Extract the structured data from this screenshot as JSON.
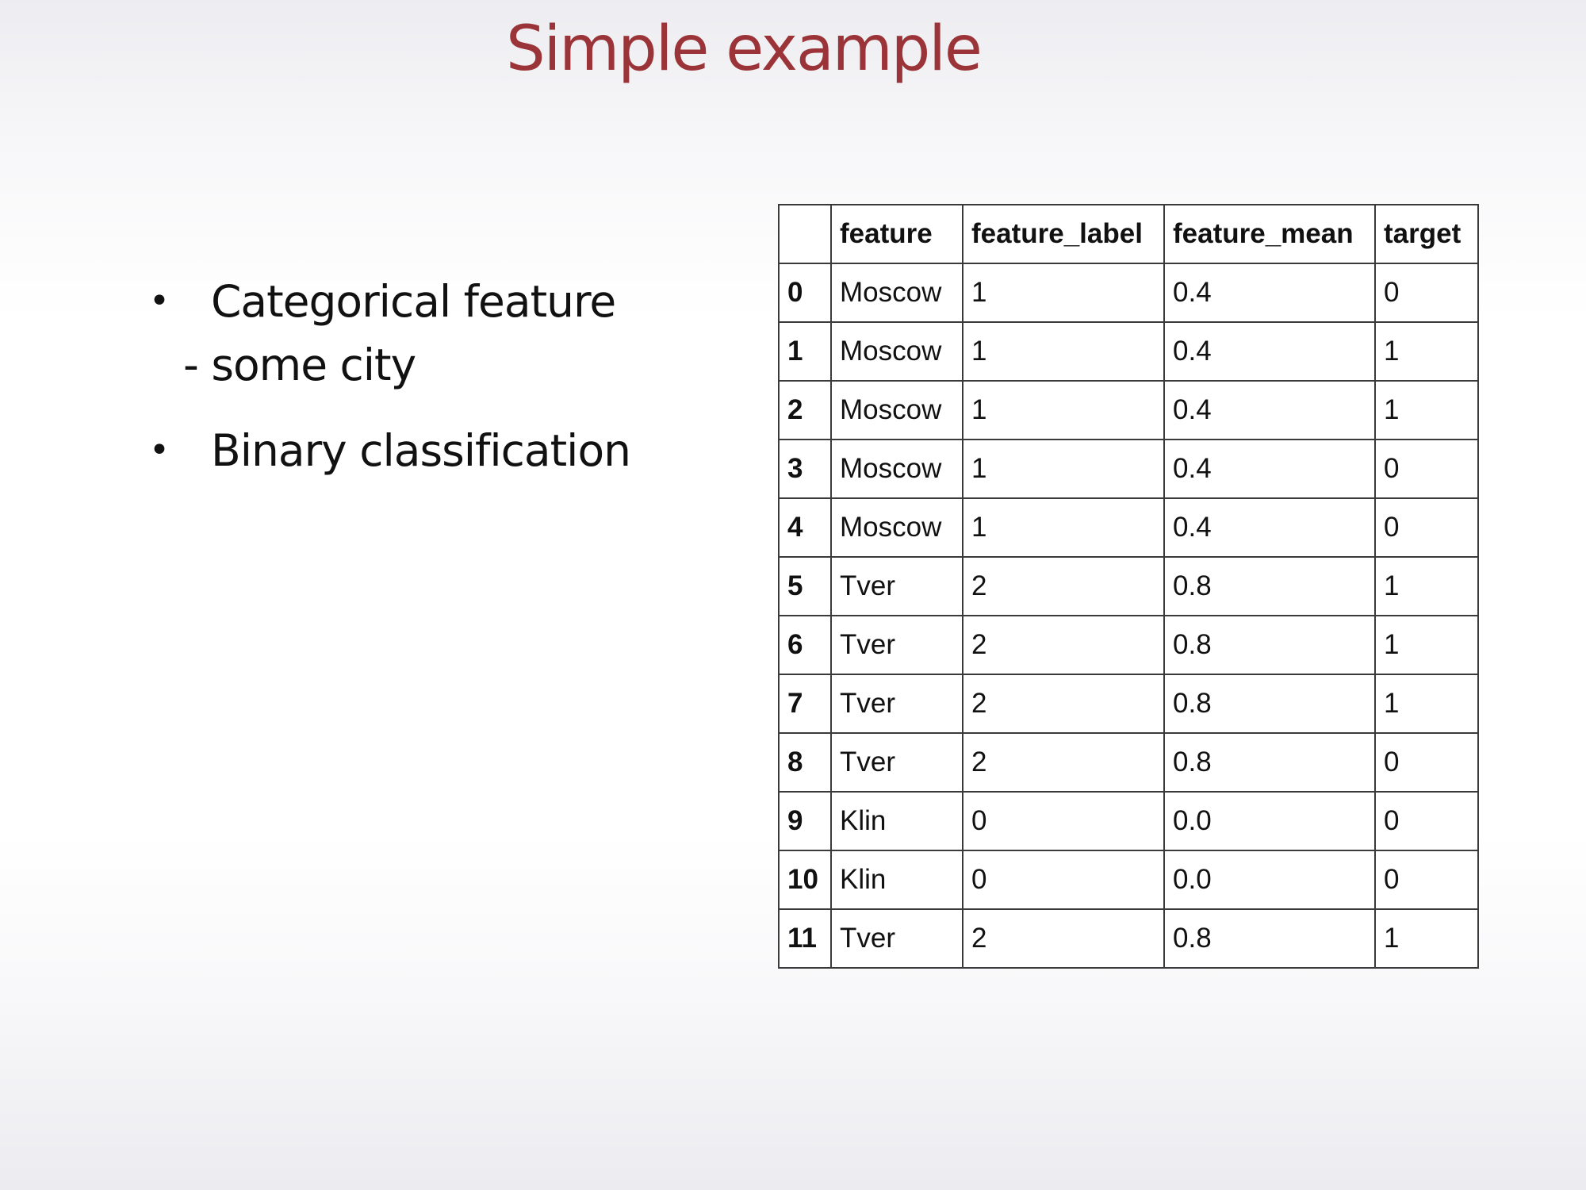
{
  "slide": {
    "title": "Simple example"
  },
  "bullets": [
    {
      "text": "Categorical feature",
      "sub": "- some city"
    },
    {
      "text": "Binary classification",
      "sub": ""
    }
  ],
  "bullet_glyph": "•",
  "table": {
    "columns": [
      "",
      "feature",
      "feature_label",
      "feature_mean",
      "target"
    ],
    "rows": [
      [
        "0",
        "Moscow",
        "1",
        "0.4",
        "0"
      ],
      [
        "1",
        "Moscow",
        "1",
        "0.4",
        "1"
      ],
      [
        "2",
        "Moscow",
        "1",
        "0.4",
        "1"
      ],
      [
        "3",
        "Moscow",
        "1",
        "0.4",
        "0"
      ],
      [
        "4",
        "Moscow",
        "1",
        "0.4",
        "0"
      ],
      [
        "5",
        "Tver",
        "2",
        "0.8",
        "1"
      ],
      [
        "6",
        "Tver",
        "2",
        "0.8",
        "1"
      ],
      [
        "7",
        "Tver",
        "2",
        "0.8",
        "1"
      ],
      [
        "8",
        "Tver",
        "2",
        "0.8",
        "0"
      ],
      [
        "9",
        "Klin",
        "0",
        "0.0",
        "0"
      ],
      [
        "10",
        "Klin",
        "0",
        "0.0",
        "0"
      ],
      [
        "11",
        "Tver",
        "2",
        "0.8",
        "1"
      ]
    ]
  },
  "colors": {
    "title": "#9b3438",
    "text": "#111111",
    "table_border": "#3a3a3a"
  }
}
